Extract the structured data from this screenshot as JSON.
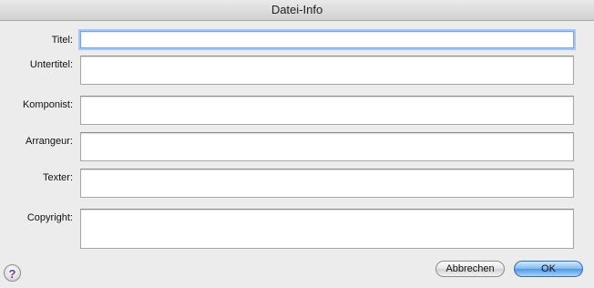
{
  "window": {
    "title": "Datei-Info"
  },
  "fields": [
    {
      "label": "Titel:",
      "value": ""
    },
    {
      "label": "Untertitel:",
      "value": ""
    },
    {
      "label": "Komponist:",
      "value": ""
    },
    {
      "label": "Arrangeur:",
      "value": ""
    },
    {
      "label": "Texter:",
      "value": ""
    },
    {
      "label": "Copyright:",
      "value": ""
    }
  ],
  "buttons": {
    "help": "?",
    "cancel": "Abbrechen",
    "ok": "OK"
  }
}
